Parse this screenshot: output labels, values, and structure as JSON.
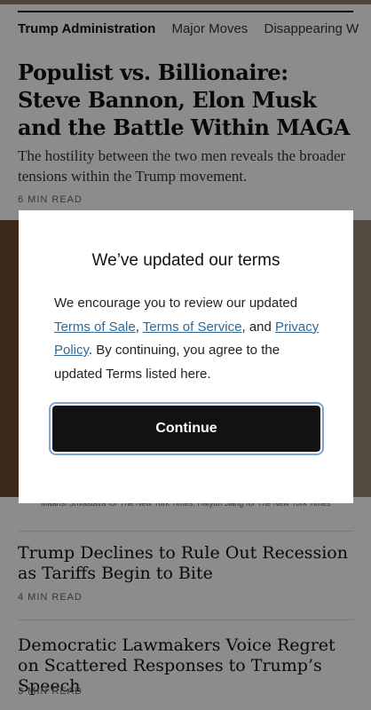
{
  "topics": [
    "Trump Administration",
    "Major Moves",
    "Disappearing W"
  ],
  "articles": [
    {
      "headline": "Populist vs. Billionaire: Steve Bannon, Elon Musk and the Battle Within MAGA",
      "summary": "The hostility between the two men reveals the broader tensions within the Trump movement.",
      "read_time": "6 MIN READ",
      "photo_credit": "Maansi Srivastava for The New York Times; Haiyun Jiang for The New York Times"
    },
    {
      "headline": "Trump Declines to Rule Out Recession as Tariffs Begin to Bite",
      "read_time": "4 MIN READ"
    },
    {
      "headline": "Democratic Lawmakers Voice Regret on Scattered Responses to Trump’s Speech",
      "read_time": "3 MIN READ"
    }
  ],
  "modal": {
    "title": "We’ve updated our terms",
    "text_intro": "We encourage you to review our updated",
    "link_terms_of_sale": "Terms of Sale",
    "sep_comma": ",",
    "link_terms_of_service": "Terms of Service",
    "text_and": ", and",
    "link_privacy_policy": "Privacy Policy",
    "text_outro": ". By continuing, you agree to the updated Terms listed here.",
    "continue_label": "Continue"
  },
  "colors": {
    "link": "#326891",
    "button_bg": "#121212",
    "focus_ring": "#7aa7d6"
  }
}
